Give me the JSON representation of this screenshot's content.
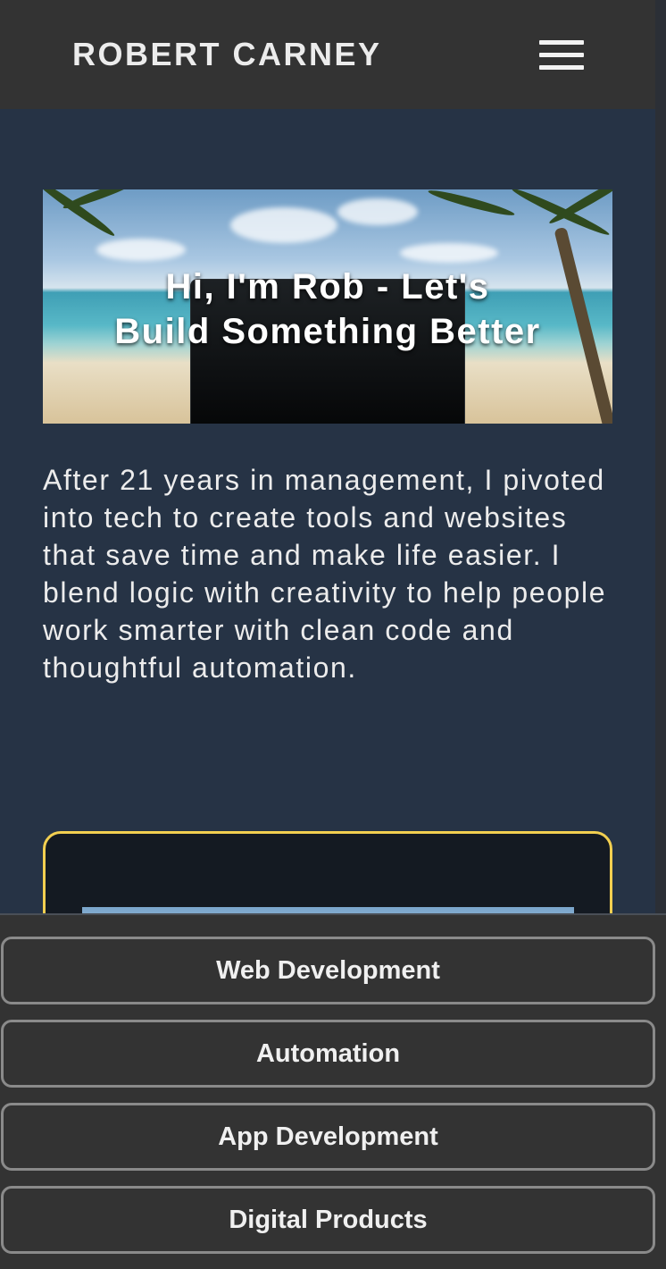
{
  "header": {
    "brand": "ROBERT CARNEY",
    "menu_icon": "hamburger-menu-icon"
  },
  "hero": {
    "title_line1": "Hi, I'm Rob - Let's",
    "title_line2": "Build Something Better",
    "background": "beach-with-palm-trees-and-laptop"
  },
  "intro": {
    "text": "After 21 years in management, I pivoted into tech to create tools and websites that save time and make life easier. I blend logic with creativity to help people work smarter with clean code and thoughtful automation."
  },
  "card": {
    "accent_color": "#f2cf50"
  },
  "bottom_nav": {
    "items": [
      {
        "label": "Web Development"
      },
      {
        "label": "Automation"
      },
      {
        "label": "App Development"
      },
      {
        "label": "Digital Products"
      }
    ]
  },
  "colors": {
    "page_bg": "#263345",
    "header_bg": "#333333",
    "text": "#ececec",
    "button_border": "#8a8a8a"
  }
}
